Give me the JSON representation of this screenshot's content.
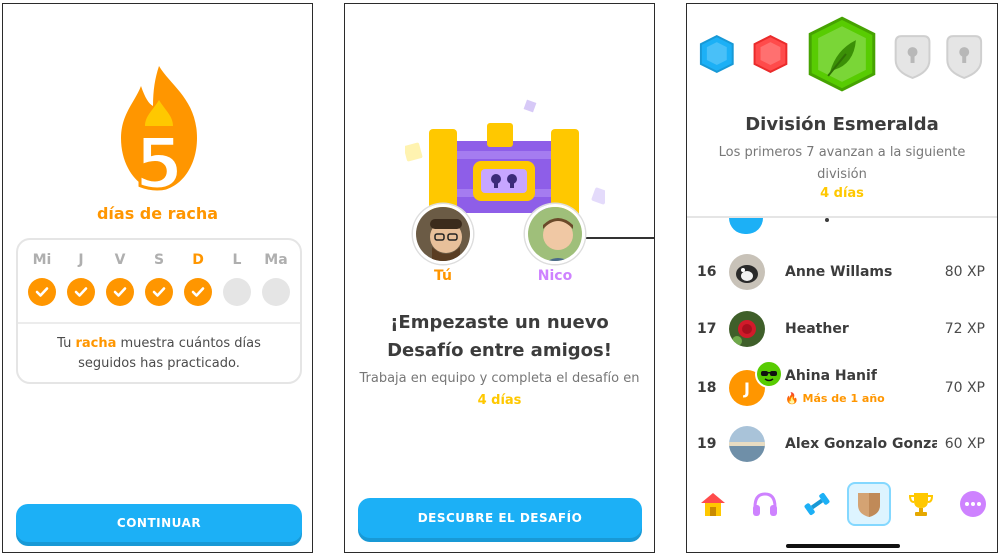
{
  "panel1": {
    "streak_count": "5",
    "streak_label": "días de racha",
    "days": [
      {
        "label": "Mi",
        "done": true,
        "today": false
      },
      {
        "label": "J",
        "done": true,
        "today": false
      },
      {
        "label": "V",
        "done": true,
        "today": false
      },
      {
        "label": "S",
        "done": true,
        "today": false
      },
      {
        "label": "D",
        "done": true,
        "today": true
      },
      {
        "label": "L",
        "done": false,
        "today": false
      },
      {
        "label": "Ma",
        "done": false,
        "today": false
      }
    ],
    "info_prefix": "Tu ",
    "info_highlight": "racha",
    "info_suffix": " muestra cuántos días seguidos has practicado.",
    "continue_label": "CONTINUAR"
  },
  "panel2": {
    "you_label": "Tú",
    "friend_label": "Nico",
    "title": "¡Empezaste un nuevo Desafío entre amigos!",
    "subtitle_prefix": "Trabaja en equipo y completa el desafío en ",
    "subtitle_highlight": "4 días",
    "cta_label": "DESCUBRE EL DESAFÍO"
  },
  "panel3": {
    "division_title": "División Esmeralda",
    "division_subtitle": "Los primeros 7 avanzan a la siguiente división",
    "division_days": "4 días",
    "leaderboard": [
      {
        "rank": "16",
        "name": "Anne Willams",
        "xp": "80 XP"
      },
      {
        "rank": "17",
        "name": "Heather",
        "xp": "72 XP"
      },
      {
        "rank": "18",
        "name": "Ahina Hanif",
        "xp": "70 XP",
        "badge": "Más de 1 año",
        "avatar_letter": "J"
      },
      {
        "rank": "19",
        "name": "Alex Gonzalo Gonza…",
        "xp": "60 XP"
      }
    ],
    "nav_icons": [
      "home-icon",
      "headphones-icon",
      "dumbbell-icon",
      "shield-icon",
      "trophy-icon",
      "more-icon"
    ],
    "colors": {
      "accent": "#1cb0f6",
      "streak": "#ff9600",
      "gold": "#ffc800",
      "emerald": "#58cc02",
      "purple": "#ce82ff"
    }
  }
}
